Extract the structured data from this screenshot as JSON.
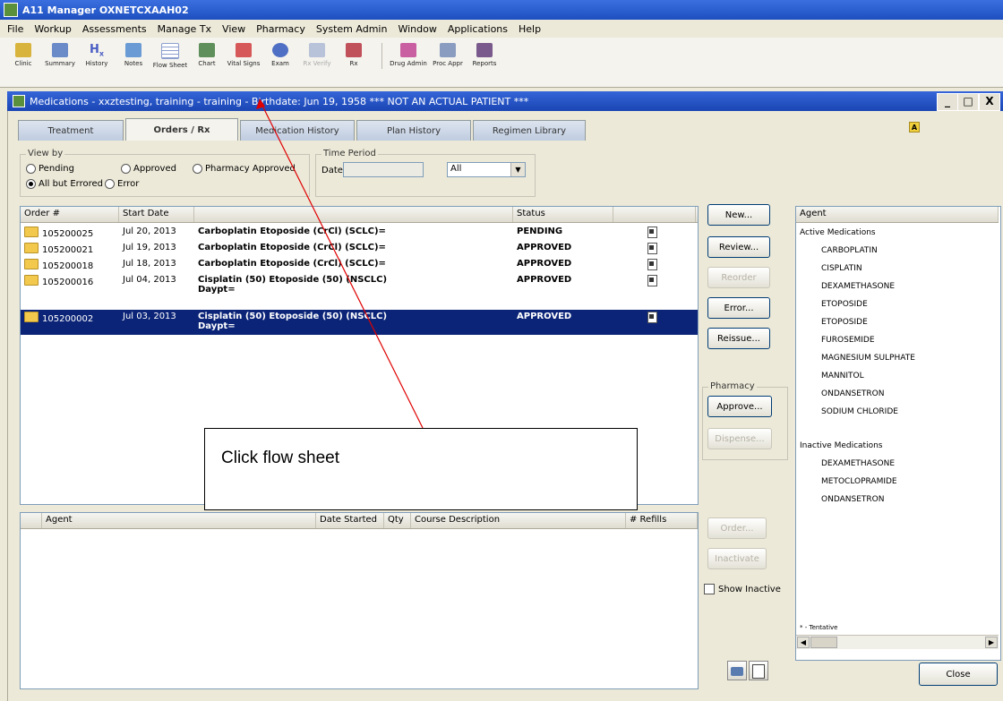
{
  "app": {
    "title": "A11 Manager OXNETCXAAH02"
  },
  "menu": [
    "File",
    "Workup",
    "Assessments",
    "Manage Tx",
    "View",
    "Pharmacy",
    "System Admin",
    "Window",
    "Applications",
    "Help"
  ],
  "toolbar": {
    "buttons": [
      {
        "label": "Clinic",
        "icon": "folder-icon",
        "color": "#d9b43c"
      },
      {
        "label": "Summary",
        "icon": "summary-icon",
        "color": "#6a8bc8"
      },
      {
        "label": "History",
        "icon": "hx-icon",
        "color": "#4b5ec4"
      },
      {
        "label": "Notes",
        "icon": "notes-icon",
        "color": "#6a9bd4"
      },
      {
        "label": "Flow Sheet",
        "icon": "flowsheet-icon",
        "color": "#8c9fcf"
      },
      {
        "label": "Chart",
        "icon": "chart-icon",
        "color": "#5f8f5a"
      },
      {
        "label": "Vital Signs",
        "icon": "vitals-icon",
        "color": "#d65858"
      },
      {
        "label": "Exam",
        "icon": "exam-icon",
        "color": "#4f6fc4"
      },
      {
        "label": "Rx Verify",
        "icon": "rx-verify-icon",
        "color": "#b8c2d8",
        "disabled": true
      },
      {
        "label": "Rx",
        "icon": "rx-icon",
        "color": "#c0505a"
      },
      {
        "label": "Drug Admin",
        "icon": "drug-admin-icon",
        "color": "#c95ea0"
      },
      {
        "label": "Proc Appr",
        "icon": "proc-appr-icon",
        "color": "#8a9cc0"
      },
      {
        "label": "Reports",
        "icon": "reports-icon",
        "color": "#7a5a8c"
      }
    ]
  },
  "window": {
    "title": "Medications - xxztesting, training - training - Birthdate: Jun 19, 1958 *** NOT AN ACTUAL PATIENT ***",
    "controls": {
      "minimize": "_",
      "maximize": "□",
      "close": "X"
    }
  },
  "tabs": [
    {
      "label": "Treatment",
      "active": false
    },
    {
      "label": "Orders / Rx",
      "active": true
    },
    {
      "label": "Medication History",
      "active": false
    },
    {
      "label": "Plan History",
      "active": false
    },
    {
      "label": "Regimen Library",
      "active": false
    }
  ],
  "view_by": {
    "title": "View by",
    "options": {
      "pending": "Pending",
      "approved": "Approved",
      "pharmacy_approved": "Pharmacy Approved",
      "all_but_errored": "All but Errored",
      "error": "Error"
    },
    "selected": "All but Errored"
  },
  "time_period": {
    "title": "Time Period",
    "date_label": "Date",
    "date_value": "",
    "range_value": "All"
  },
  "orders": {
    "columns": [
      "Order #",
      "Start Date",
      "",
      "Status",
      ""
    ],
    "rows": [
      {
        "order": "105200025",
        "date": "Jul 20, 2013",
        "desc": "Carboplatin Etoposide (CrCl) (SCLC)=",
        "desc2": "",
        "status": "PENDING"
      },
      {
        "order": "105200021",
        "date": "Jul 19, 2013",
        "desc": "Carboplatin Etoposide (CrCl) (SCLC)=",
        "desc2": "",
        "status": "APPROVED"
      },
      {
        "order": "105200018",
        "date": "Jul 18, 2013",
        "desc": "Carboplatin Etoposide (CrCl) (SCLC)=",
        "desc2": "",
        "status": "APPROVED"
      },
      {
        "order": "105200016",
        "date": "Jul 04, 2013",
        "desc": "Cisplatin (50) Etoposide (50) (NSCLC)",
        "desc2": "Daypt=",
        "status": "APPROVED"
      },
      {
        "order": "105200002",
        "date": "Jul 03, 2013",
        "desc": "Cisplatin (50) Etoposide (50) (NSCLC)",
        "desc2": "Daypt=",
        "status": "APPROVED",
        "selected": true
      }
    ]
  },
  "order_buttons": {
    "new": "New...",
    "review": "Review...",
    "reorder": "Reorder",
    "error": "Error...",
    "reissue": "Reissue..."
  },
  "pharmacy": {
    "title": "Pharmacy",
    "approve": "Approve...",
    "dispense": "Dispense..."
  },
  "agent_grid": {
    "columns": [
      "Agent",
      "Date Started",
      "Qty",
      "Course Description",
      "# Refills"
    ]
  },
  "agent_buttons": {
    "order": "Order...",
    "inactivate": "Inactivate",
    "show_inactive": "Show Inactive"
  },
  "agent_panel": {
    "header": "Agent",
    "active_title": "Active Medications",
    "active": [
      "CARBOPLATIN",
      "CISPLATIN",
      "DEXAMETHASONE",
      "ETOPOSIDE",
      "ETOPOSIDE",
      "FUROSEMIDE",
      "MAGNESIUM SULPHATE",
      "MANNITOL",
      "ONDANSETRON",
      "SODIUM CHLORIDE"
    ],
    "inactive_title": "Inactive Medications",
    "inactive": [
      "DEXAMETHASONE",
      "METOCLOPRAMIDE",
      "ONDANSETRON"
    ],
    "footnote": "* - Tentative"
  },
  "footer": {
    "close": "Close"
  },
  "annotation": {
    "text": "Click flow sheet",
    "arrow_color": "#e00000"
  }
}
